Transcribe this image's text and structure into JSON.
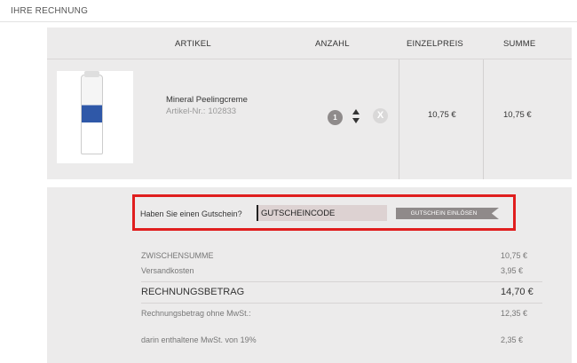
{
  "header": {
    "title": "IHRE RECHNUNG"
  },
  "table": {
    "columns": {
      "artikel": "ARTIKEL",
      "anzahl": "ANZAHL",
      "einzelpreis": "EINZELPREIS",
      "summe": "SUMME"
    },
    "items": [
      {
        "name": "Mineral Peelingcreme",
        "article_label": "Artikel-Nr.:",
        "article_no": "102833",
        "quantity": "1",
        "unit_price": "10,75 €",
        "total": "10,75 €",
        "image_icon": "product-tube-image"
      }
    ],
    "remove_label": "X"
  },
  "voucher": {
    "question": "Haben Sie einen Gutschein?",
    "input_value": "GUTSCHEINCODE",
    "button_label": "GUTSCHEIN EINLÖSEN",
    "highlight_color": "#e01e1e"
  },
  "totals": {
    "subtotal_label": "ZWISCHENSUMME",
    "subtotal_value": "10,75 €",
    "shipping_label": "Versandkosten",
    "shipping_value": "3,95 €",
    "invoice_label": "RECHNUNGSBETRAG",
    "invoice_value": "14,70 €",
    "net_label": "Rechnungsbetrag ohne MwSt.:",
    "net_value": "12,35 €",
    "vat_label": "darin enthaltene MwSt. von 19%",
    "vat_value": "2,35 €"
  }
}
